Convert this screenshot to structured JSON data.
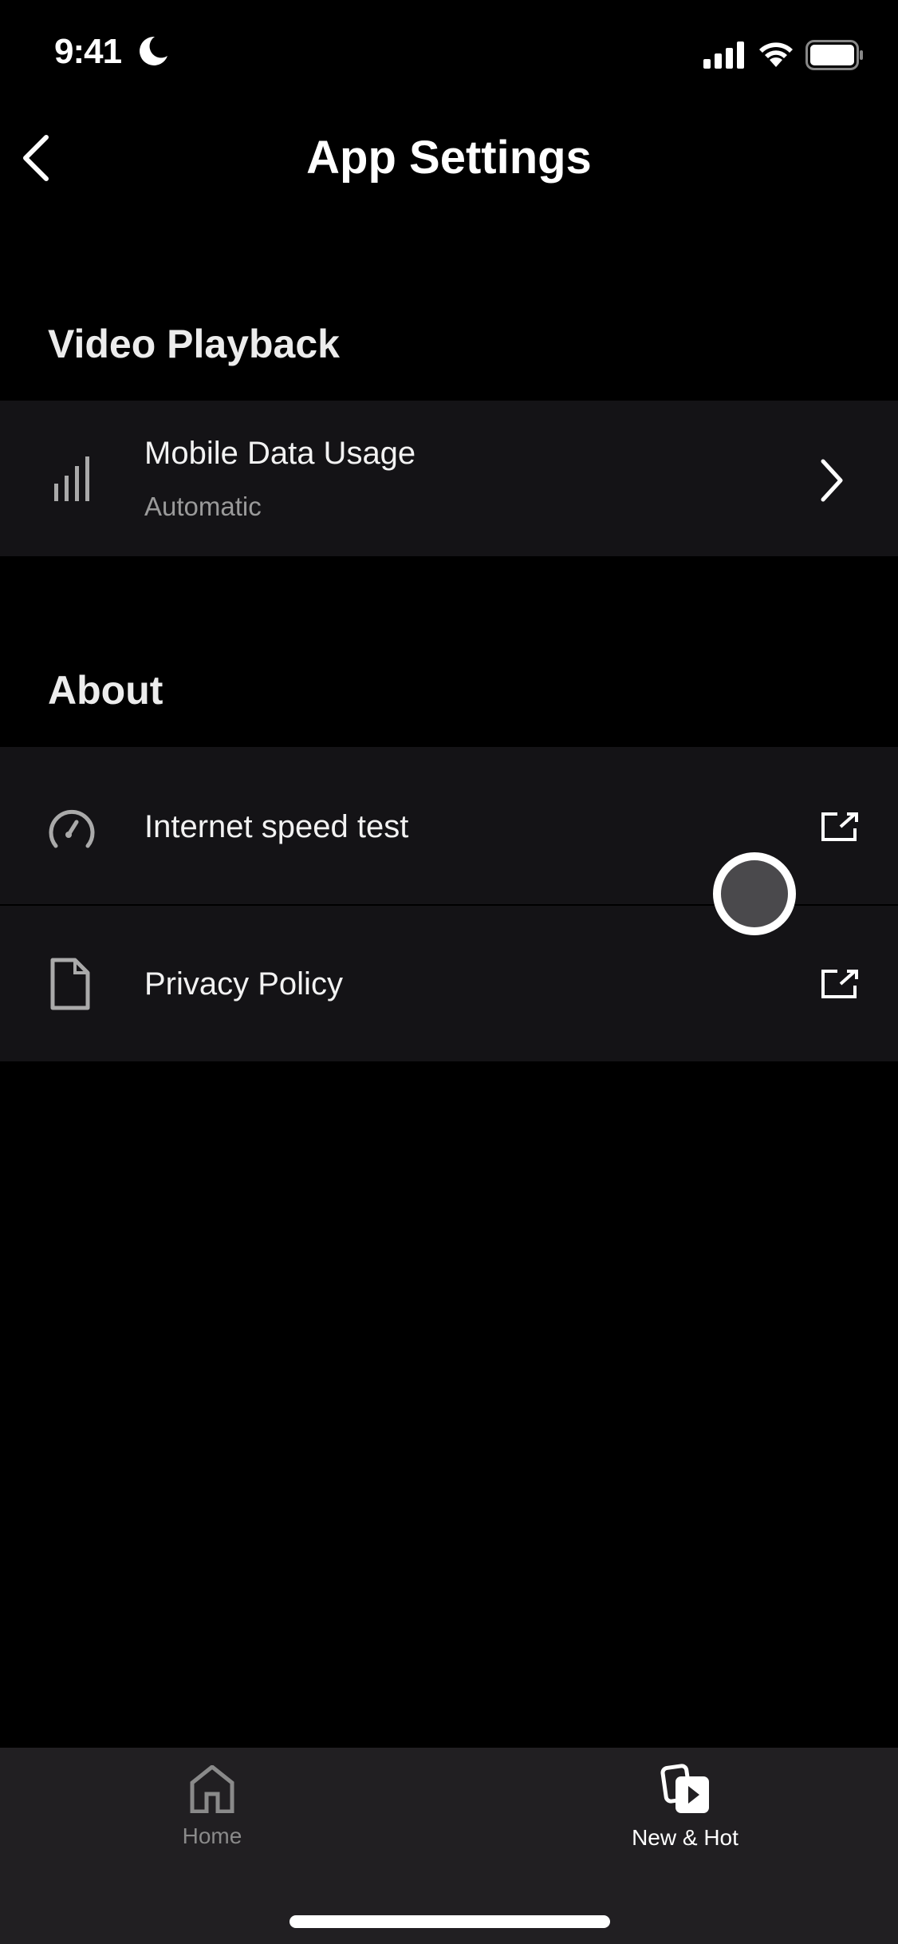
{
  "status_bar": {
    "time": "9:41",
    "icons": [
      "moon-icon",
      "signal-icon",
      "wifi-icon",
      "battery-icon"
    ]
  },
  "header": {
    "title": "App Settings",
    "back_icon": "chevron-left-icon"
  },
  "sections": [
    {
      "title": "Video Playback",
      "items": [
        {
          "label": "Mobile Data Usage",
          "subtitle": "Automatic",
          "icon": "signal-bars-icon",
          "trailing": "chevron-right-icon"
        }
      ]
    },
    {
      "title": "About",
      "items": [
        {
          "label": "Internet speed test",
          "icon": "speedometer-icon",
          "trailing": "external-link-icon"
        },
        {
          "label": "Privacy Policy",
          "icon": "document-icon",
          "trailing": "external-link-icon"
        }
      ]
    }
  ],
  "tabbar": {
    "tabs": [
      {
        "label": "Home",
        "icon": "home-icon",
        "active": false
      },
      {
        "label": "New & Hot",
        "icon": "new-hot-icon",
        "active": true
      }
    ]
  },
  "colors": {
    "background": "#000000",
    "row": "#141316",
    "tabbar": "#211f22",
    "muted": "#9a9a9a"
  }
}
